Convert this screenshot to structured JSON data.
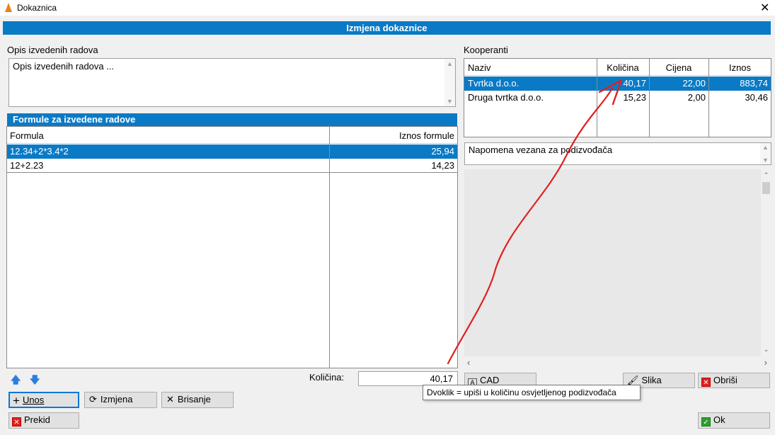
{
  "window": {
    "title": "Dokaznica"
  },
  "header": {
    "title": "Izmjena dokaznice"
  },
  "opis": {
    "label": "Opis izvedenih radova",
    "value": "Opis izvedenih radova ..."
  },
  "formule": {
    "title": "Formule za izvedene radove",
    "columns": [
      "Formula",
      "Iznos formule"
    ],
    "rows": [
      {
        "formula": "12.34+2*3.4*2",
        "iznos": "25,94"
      },
      {
        "formula": "12+2.23",
        "iznos": "14,23"
      }
    ]
  },
  "kolicina": {
    "label": "Količina:",
    "value": "40,17"
  },
  "tooltip": "Dvoklik = upiši u količinu osvjetljenog podizvođača",
  "kooperanti": {
    "label": "Kooperanti",
    "columns": [
      "Naziv",
      "Količina",
      "Cijena",
      "Iznos"
    ],
    "rows": [
      {
        "naziv": "Tvrtka d.o.o.",
        "kolicina": "40,17",
        "cijena": "22,00",
        "iznos": "883,74"
      },
      {
        "naziv": "Druga tvrtka d.o.o.",
        "kolicina": "15,23",
        "cijena": "2,00",
        "iznos": "30,46"
      }
    ],
    "napomena": "Napomena vezana za podizvođača"
  },
  "buttons": {
    "unos": "Unos",
    "izmjena": "Izmjena",
    "brisanje": "Brisanje",
    "prekid": "Prekid",
    "cad": "CAD",
    "slika": "Slika",
    "obrisi": "Obriši",
    "ok": "Ok"
  },
  "colors": {
    "accent": "#0a7ac6",
    "annotation": "#e02020"
  }
}
